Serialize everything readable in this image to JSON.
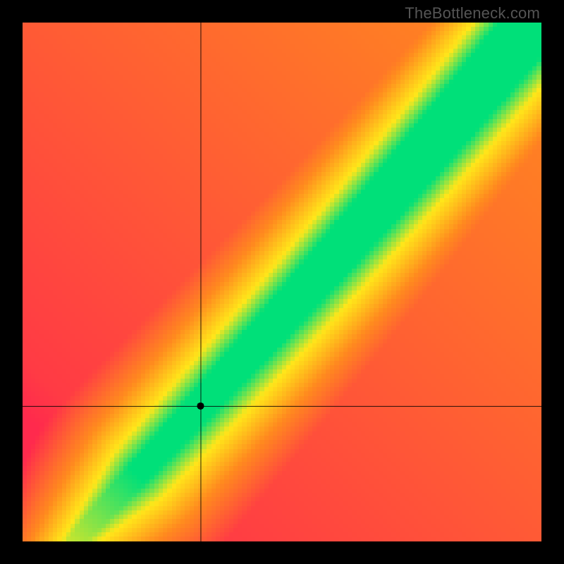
{
  "watermark": "TheBottleneck.com",
  "chart_data": {
    "type": "heatmap",
    "title": "",
    "xlabel": "",
    "ylabel": "",
    "xlim": [
      0,
      1
    ],
    "ylim": [
      0,
      1
    ],
    "axis_x_rel": 0.343,
    "axis_y_rel": 0.261,
    "marker": {
      "x_rel": 0.343,
      "y_rel": 0.261,
      "radius_px": 5
    },
    "colors": {
      "red": "#ff2a4d",
      "orange": "#ff8a1f",
      "yellow": "#ffe71a",
      "green": "#00e07a"
    },
    "band": {
      "description": "Green optimal band roughly along y ≈ x, widening with x",
      "center_fn": "anchored through marker; slope ~1 with slight upward curvature",
      "half_width_start": 0.012,
      "half_width_end": 0.085
    },
    "pixel_grid": 118
  }
}
